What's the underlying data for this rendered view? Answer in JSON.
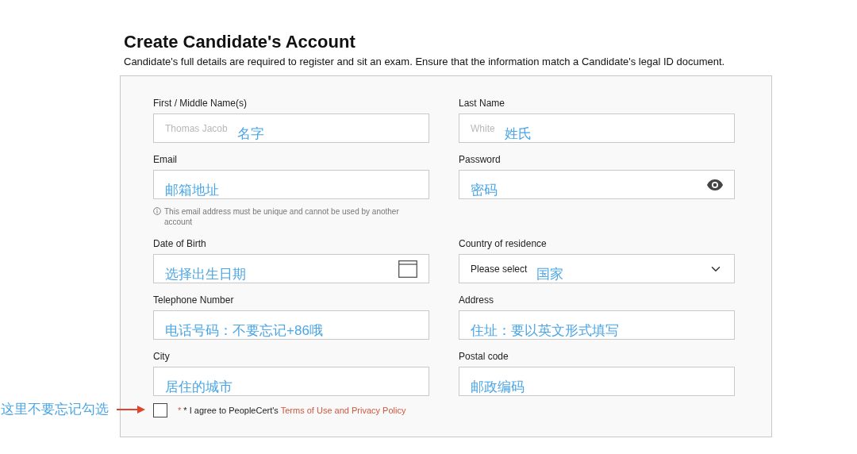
{
  "title": "Create Candidate's Account",
  "subtitle": "Candidate's full details are required to register and sit an exam. Ensure that the information match a Candidate's legal ID document.",
  "fields": [
    {
      "kind": "text",
      "label": "First / Middle Name(s)",
      "placeholder": "Thomas Jacob",
      "annotation": "名字"
    },
    {
      "kind": "text",
      "label": "Last Name",
      "placeholder": "White",
      "annotation": "姓氏"
    },
    {
      "kind": "text",
      "label": "Email",
      "annotation": "邮箱地址",
      "hint": "This email address must be unique and cannot be used by another account"
    },
    {
      "kind": "password",
      "label": "Password",
      "annotation": "密码"
    },
    {
      "kind": "date",
      "label": "Date of Birth",
      "annotation": "选择出生日期"
    },
    {
      "kind": "select",
      "label": "Country of residence",
      "value": "Please select",
      "annotation": "国家"
    },
    {
      "kind": "text",
      "label": "Telephone Number",
      "annotation": "电话号码：不要忘记+86哦"
    },
    {
      "kind": "text",
      "label": "Address",
      "annotation": "住址：要以英文形式填写"
    },
    {
      "kind": "text",
      "label": "City",
      "annotation": "居住的城市"
    },
    {
      "kind": "text",
      "label": "Postal code",
      "annotation": "邮政编码"
    }
  ],
  "agreement": {
    "checked": false,
    "required_mark": "*",
    "text": "* I agree to PeopleCert's",
    "link": "Terms of Use and Privacy Policy",
    "annotation": "这里不要忘记勾选"
  }
}
